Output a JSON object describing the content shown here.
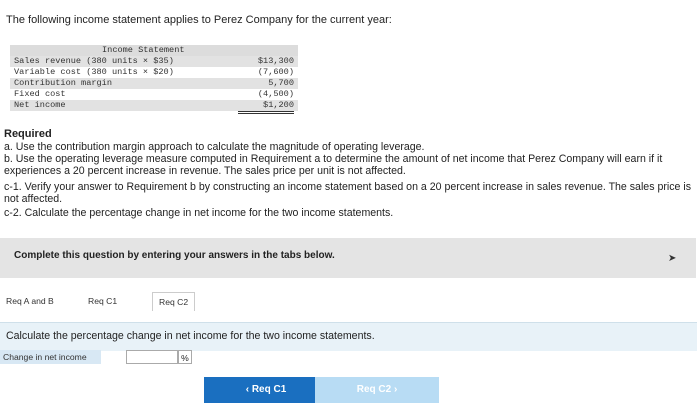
{
  "intro": "The following income statement applies to Perez Company for the current year:",
  "statement": {
    "title": "Income Statement",
    "rows": [
      {
        "label": "Sales revenue (380 units × $35)",
        "amount": "$13,300"
      },
      {
        "label": "Variable cost (380 units × $20)",
        "amount": "(7,600)"
      },
      {
        "label": "Contribution margin",
        "amount": "5,700"
      },
      {
        "label": "Fixed cost",
        "amount": "(4,500)"
      },
      {
        "label": "Net income",
        "amount": "$1,200"
      }
    ]
  },
  "required": {
    "title": "Required",
    "items": [
      "a. Use the contribution margin approach to calculate the magnitude of operating leverage.",
      "b. Use the operating leverage measure computed in Requirement a to determine the amount of net income that Perez Company will earn if it experiences a 20 percent increase in revenue. The sales price per unit is not affected.",
      "c-1. Verify your answer to Requirement b by constructing an income statement based on a 20 percent increase in sales revenue. The sales price is not affected.",
      "c-2. Calculate the percentage change in net income for the two income statements."
    ]
  },
  "instruction_bar": "Complete this question by entering your answers in the tabs below.",
  "tabs": [
    "Req A and B",
    "Req C1",
    "Req C2"
  ],
  "panel_text": "Calculate the percentage change in net income for the two income statements.",
  "answer": {
    "label": "Change in net income",
    "value": "",
    "unit": "%"
  },
  "nav": {
    "prev": "‹  Req C1",
    "next": "Req C2  ›"
  },
  "colors": {
    "primary": "#1a6fc0",
    "primary_light": "#b8dcf4",
    "panel_bg": "#e8f2f8"
  }
}
